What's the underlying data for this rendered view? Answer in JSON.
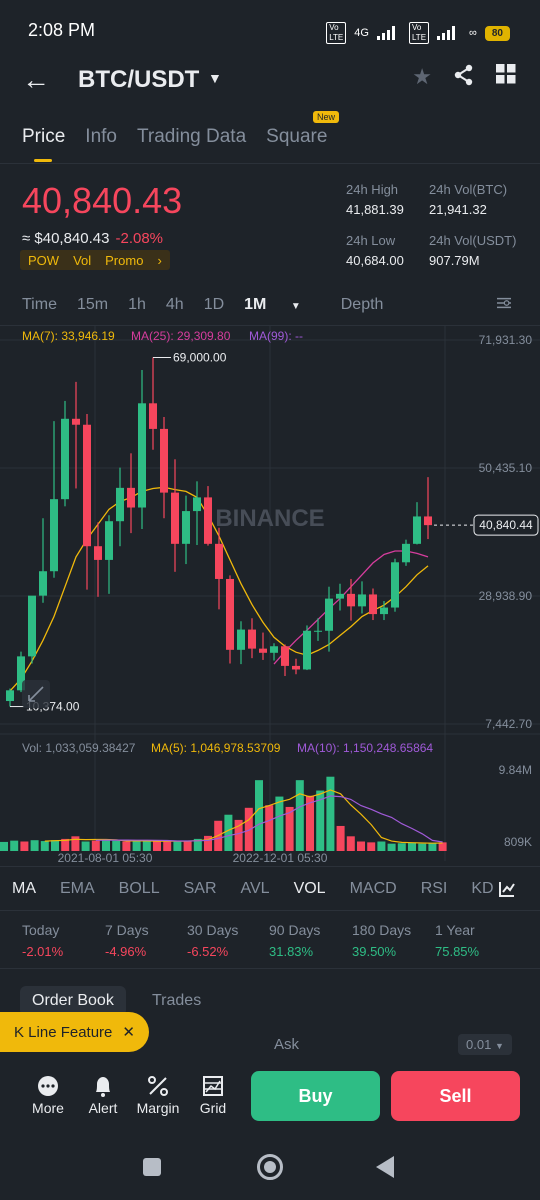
{
  "status": {
    "time": "2:08 PM",
    "battery": "80",
    "net": "4G"
  },
  "header": {
    "pair": "BTC/USDT"
  },
  "tabs": [
    "Price",
    "Info",
    "Trading Data",
    "Square"
  ],
  "new_badge": "New",
  "price": {
    "last": "40,840.43",
    "fiat": "≈ $40,840.43",
    "change": "-2.08%",
    "chips": [
      "POW",
      "Vol",
      "Promo"
    ]
  },
  "stats": {
    "high_label": "24h High",
    "high": "41,881.39",
    "volbtc_label": "24h Vol(BTC)",
    "volbtc": "21,941.32",
    "low_label": "24h Low",
    "low": "40,684.00",
    "volusdt_label": "24h Vol(USDT)",
    "volusdt": "907.79M"
  },
  "intervals": [
    "Time",
    "15m",
    "1h",
    "4h",
    "1D",
    "1M",
    "Depth"
  ],
  "selected_interval": "1M",
  "ma_legend": {
    "ma7": "MA(7): 33,946.19",
    "ma25": "MA(25): 29,309.80",
    "ma99": "MA(99): --"
  },
  "vol_legend": {
    "vol": "Vol: 1,033,059.38427",
    "ma5": "MA(5): 1,046,978.53709",
    "ma10": "MA(10): 1,150,248.65864"
  },
  "watermark": "BINANCE",
  "chart_data": {
    "type": "candlestick",
    "price_axis": [
      "71,931.30",
      "50,435.10",
      "28,938.90",
      "7,442.70"
    ],
    "volume_axis": [
      "9.84M",
      "809K"
    ],
    "time_labels": [
      "2021-08-01 05:30",
      "2022-12-01 05:30"
    ],
    "max_label": "69,000.00",
    "min_label": "10,374.00",
    "current_label": "40,840.44",
    "ylim": [
      7442.7,
      71931.3
    ],
    "candles": [
      {
        "o": 11300,
        "h": 13400,
        "l": 10374,
        "c": 13100
      },
      {
        "o": 13100,
        "h": 19600,
        "l": 12800,
        "c": 18800
      },
      {
        "o": 18800,
        "h": 24200,
        "l": 17600,
        "c": 29000
      },
      {
        "o": 29000,
        "h": 42000,
        "l": 27800,
        "c": 33100
      },
      {
        "o": 33100,
        "h": 58300,
        "l": 32000,
        "c": 45200
      },
      {
        "o": 45200,
        "h": 61700,
        "l": 44000,
        "c": 58700
      },
      {
        "o": 58700,
        "h": 64900,
        "l": 47000,
        "c": 57700
      },
      {
        "o": 57700,
        "h": 59500,
        "l": 30000,
        "c": 37300
      },
      {
        "o": 37300,
        "h": 41300,
        "l": 28800,
        "c": 35000
      },
      {
        "o": 35000,
        "h": 42500,
        "l": 29300,
        "c": 41500
      },
      {
        "o": 41500,
        "h": 50500,
        "l": 37300,
        "c": 47100
      },
      {
        "o": 47100,
        "h": 52900,
        "l": 39500,
        "c": 43800
      },
      {
        "o": 43800,
        "h": 66900,
        "l": 40200,
        "c": 61300
      },
      {
        "o": 61300,
        "h": 69000,
        "l": 53500,
        "c": 57000
      },
      {
        "o": 57000,
        "h": 59000,
        "l": 42000,
        "c": 46300
      },
      {
        "o": 46300,
        "h": 51900,
        "l": 33000,
        "c": 37700
      },
      {
        "o": 37700,
        "h": 45800,
        "l": 34300,
        "c": 43200
      },
      {
        "o": 43200,
        "h": 48200,
        "l": 37500,
        "c": 45500
      },
      {
        "o": 45500,
        "h": 47400,
        "l": 37400,
        "c": 37700
      },
      {
        "o": 37700,
        "h": 40400,
        "l": 26700,
        "c": 31800
      },
      {
        "o": 31800,
        "h": 32400,
        "l": 17600,
        "c": 19900
      },
      {
        "o": 19900,
        "h": 24700,
        "l": 17500,
        "c": 23300
      },
      {
        "o": 23300,
        "h": 25200,
        "l": 18500,
        "c": 20100
      },
      {
        "o": 20100,
        "h": 22800,
        "l": 18200,
        "c": 19400
      },
      {
        "o": 19400,
        "h": 21000,
        "l": 18100,
        "c": 20500
      },
      {
        "o": 20500,
        "h": 20800,
        "l": 15500,
        "c": 17200
      },
      {
        "o": 17200,
        "h": 18400,
        "l": 15800,
        "c": 16600
      },
      {
        "o": 16600,
        "h": 24000,
        "l": 16500,
        "c": 23100
      },
      {
        "o": 23100,
        "h": 25200,
        "l": 21400,
        "c": 23100
      },
      {
        "o": 23100,
        "h": 30500,
        "l": 19600,
        "c": 28500
      },
      {
        "o": 28500,
        "h": 31000,
        "l": 26500,
        "c": 29300
      },
      {
        "o": 29300,
        "h": 31800,
        "l": 24800,
        "c": 27200
      },
      {
        "o": 27200,
        "h": 31400,
        "l": 26000,
        "c": 29200
      },
      {
        "o": 29200,
        "h": 30200,
        "l": 24900,
        "c": 25900
      },
      {
        "o": 25900,
        "h": 28100,
        "l": 24900,
        "c": 27000
      },
      {
        "o": 27000,
        "h": 35200,
        "l": 26300,
        "c": 34600
      },
      {
        "o": 34600,
        "h": 38400,
        "l": 34000,
        "c": 37700
      },
      {
        "o": 37700,
        "h": 44700,
        "l": 37600,
        "c": 42300
      },
      {
        "o": 42300,
        "h": 48900,
        "l": 38500,
        "c": 40840
      }
    ],
    "ma7": [
      13000,
      15000,
      18000,
      21500,
      25500,
      30500,
      35500,
      38500,
      41000,
      43500,
      44800,
      45500,
      46500,
      47000,
      47200,
      46800,
      46500,
      45500,
      42500,
      39000,
      35000,
      31000,
      27500,
      24500,
      22000,
      20500,
      19500,
      19000,
      19800,
      20800,
      22300,
      23800,
      25500,
      26500,
      27400,
      28800,
      30500,
      32500,
      34000
    ],
    "ma25": [
      null,
      null,
      null,
      null,
      null,
      null,
      null,
      null,
      null,
      null,
      null,
      null,
      null,
      null,
      null,
      null,
      null,
      null,
      null,
      null,
      null,
      null,
      null,
      null,
      17500,
      19600,
      21500,
      23200,
      25000,
      26800,
      28500,
      30500,
      32500,
      34500,
      35900,
      36500,
      36500,
      36100,
      35500,
      34800,
      33500,
      31700,
      30600,
      30000,
      29500,
      29200,
      29000,
      28500,
      28200
    ],
    "volumes": [
      1.05,
      1.2,
      1.1,
      1.25,
      1.15,
      1.25,
      1.4,
      1.7,
      1.1,
      1.2,
      1.25,
      1.2,
      1.1,
      1.1,
      1.2,
      1.15,
      1.1,
      1.15,
      1.15,
      1.4,
      1.75,
      3.5,
      4.2,
      3.6,
      5.0,
      8.2,
      5.3,
      6.3,
      5.1,
      8.2,
      6.4,
      7.0,
      8.6,
      2.9,
      1.7,
      1.1,
      1.0,
      1.1,
      0.85,
      0.9,
      0.95,
      0.85,
      0.95,
      1.0
    ],
    "volume_up": [
      true,
      true,
      false,
      true,
      true,
      true,
      false,
      false,
      true,
      false,
      true,
      true,
      false,
      true,
      true,
      false,
      false,
      true,
      false,
      true,
      false,
      false,
      true,
      false,
      false,
      true,
      false,
      true,
      false,
      true,
      false,
      true,
      true,
      false,
      false,
      false,
      false,
      true,
      true,
      true,
      true,
      true,
      true,
      false
    ]
  },
  "indicators": [
    "MA",
    "EMA",
    "BOLL",
    "SAR",
    "AVL",
    "VOL",
    "MACD",
    "RSI",
    "KD"
  ],
  "performance": [
    {
      "label": "Today",
      "value": "-2.01%"
    },
    {
      "label": "7 Days",
      "value": "-4.96%"
    },
    {
      "label": "30 Days",
      "value": "-6.52%"
    },
    {
      "label": "90 Days",
      "value": "31.83%"
    },
    {
      "label": "180 Days",
      "value": "39.50%"
    },
    {
      "label": "1 Year",
      "value": "75.85%"
    }
  ],
  "orderbook": {
    "tab": "Order Book",
    "trades": "Trades",
    "kline": "K Line Feature",
    "ask": "Ask",
    "precision": "0.01"
  },
  "actions": [
    "More",
    "Alert",
    "Margin",
    "Grid"
  ],
  "buttons": {
    "buy": "Buy",
    "sell": "Sell"
  },
  "colors": {
    "up": "#2ebd85",
    "down": "#f6465d",
    "accent": "#f0b90b",
    "ma7": "#f0b90b",
    "ma25": "#d63d9d"
  }
}
